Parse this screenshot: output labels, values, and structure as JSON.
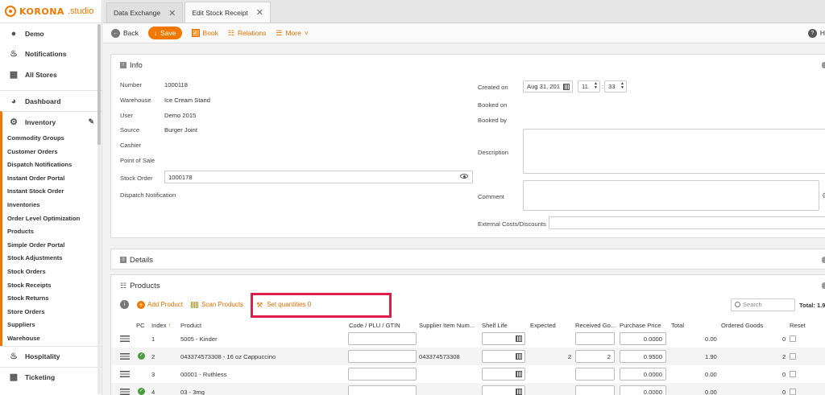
{
  "logo": {
    "brand": "KORONA",
    "suffix": ".studio"
  },
  "sidebar": {
    "top_items": [
      {
        "label": "Demo",
        "icon": "user-icon"
      },
      {
        "label": "Notifications",
        "icon": "bell-icon"
      },
      {
        "label": "All Stores",
        "icon": "store-icon"
      }
    ],
    "dashboard": "Dashboard",
    "inventory": "Inventory",
    "inventory_items": [
      "Commodity Groups",
      "Customer Orders",
      "Dispatch Notifications",
      "Instant Order Portal",
      "Instant Stock Order",
      "Inventories",
      "Order Level Optimization",
      "Products",
      "Simple Order Portal",
      "Stock Adjustments",
      "Stock Orders",
      "Stock Receipts",
      "Stock Returns",
      "Store Orders",
      "Suppliers",
      "Warehouse"
    ],
    "hospitality": "Hospitality",
    "ticketing": "Ticketing"
  },
  "tabs": [
    {
      "label": "Data Exchange",
      "active": false
    },
    {
      "label": "Edit Stock Receipt",
      "active": true
    }
  ],
  "toolbar": {
    "back": "Back",
    "save": "Save",
    "book": "Book",
    "relations": "Relations",
    "more": "More",
    "help": "H"
  },
  "info": {
    "title": "Info",
    "number_label": "Number",
    "number": "1000118",
    "warehouse_label": "Warehouse",
    "warehouse": "Ice Cream Stand",
    "user_label": "User",
    "user": "Demo 2015",
    "source_label": "Source",
    "source": "Burger Joint",
    "cashier_label": "Cashier",
    "pos_label": "Point of Sale",
    "stock_order_label": "Stock Order",
    "stock_order": "1000178",
    "dispatch_label": "Dispatch Notification",
    "created_on_label": "Created on",
    "created_date": "Aug 31, 201",
    "created_hour": "11",
    "created_min": "33",
    "booked_on_label": "Booked on",
    "booked_by_label": "Booked by",
    "description_label": "Description",
    "comment_label": "Comment",
    "external_costs_label": "External Costs/Discounts"
  },
  "details": {
    "title": "Details"
  },
  "products": {
    "title": "Products",
    "add_product": "Add Product",
    "scan_products": "Scan Products",
    "set_quantities": "Set quantities 0",
    "search_placeholder": "Search",
    "total_label": "Total: 1.9",
    "columns": [
      "PC",
      "Index",
      "Product",
      "Code / PLU / GTIN",
      "Supplier Item Num...",
      "Shelf Life",
      "Expected",
      "Received Go...",
      "Purchase Price",
      "Total",
      "Ordered Goods",
      "Reset"
    ],
    "rows": [
      {
        "pc": false,
        "index": "1",
        "product": "5005 - Kinder",
        "code": "",
        "supplier_item": "",
        "expected": "",
        "received": "",
        "price": "0.0000",
        "total": "0.00",
        "ordered": "0"
      },
      {
        "pc": true,
        "index": "2",
        "product": "043374573308 - 16 oz Cappuccino",
        "code": "",
        "supplier_item": "043374573308",
        "expected": "2",
        "received": "2",
        "price": "0.9500",
        "total": "1.90",
        "ordered": "2"
      },
      {
        "pc": false,
        "index": "3",
        "product": "00001 - Ruthless",
        "code": "",
        "supplier_item": "",
        "expected": "",
        "received": "",
        "price": "0.0000",
        "total": "0.00",
        "ordered": "0"
      },
      {
        "pc": true,
        "index": "4",
        "product": "03 - 3mg",
        "code": "",
        "supplier_item": "",
        "expected": "",
        "received": "",
        "price": "0.0000",
        "total": "0.00",
        "ordered": "0"
      }
    ]
  },
  "colors": {
    "accent": "#f07800",
    "highlight": "#e01e4b",
    "pc_ok": "#4a9b3d"
  }
}
